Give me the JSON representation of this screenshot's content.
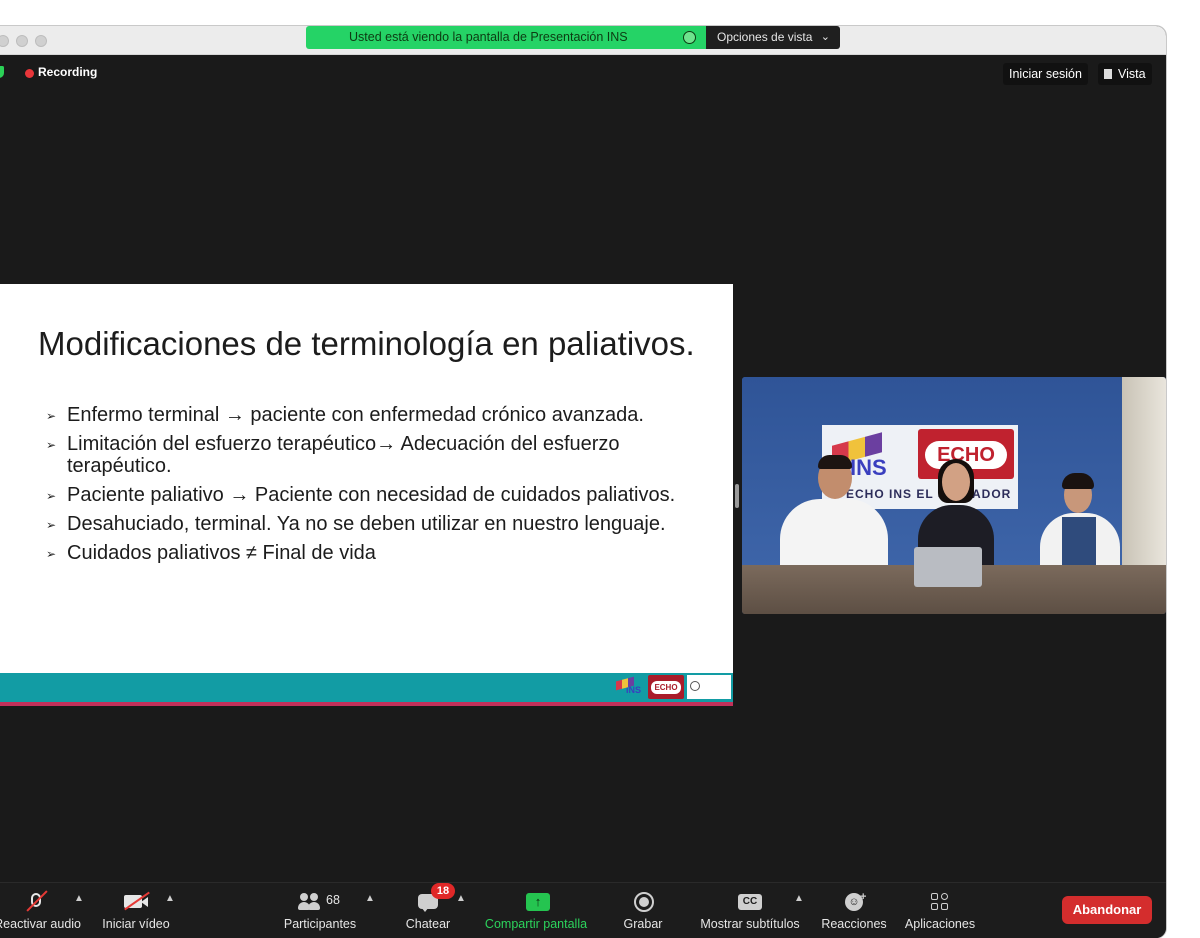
{
  "banner": {
    "sharing_text": "Usted está viendo la pantalla de Presentación INS",
    "view_options_label": "Opciones de vista"
  },
  "top_bar": {
    "recording_label": "Recording",
    "signin_label": "Iniciar sesión",
    "view_label": "Vista"
  },
  "slide": {
    "title": "Modificaciones de terminología en paliativos.",
    "bullets": [
      "Enfermo terminal → paciente con enfermedad crónico avanzada.",
      "Limitación del esfuerzo terapéutico→ Adecuación del esfuerzo terapéutico.",
      "Paciente paliativo → Paciente con necesidad de cuidados paliativos.",
      "Desahuciado, terminal. Ya no se deben utilizar en nuestro lenguaje.",
      "Cuidados paliativos ≠ Final de vida"
    ],
    "bullet_marker": "➢",
    "footer_logos": {
      "ins": "INS",
      "echo": "ECHO"
    }
  },
  "video": {
    "banner_ins": "INS",
    "banner_echo": "ECHO",
    "banner_caption": "ECHO INS EL SALVADOR"
  },
  "toolbar": {
    "audio_label": "Reactivar audio",
    "video_label": "Iniciar vídeo",
    "participants_label": "Participantes",
    "participants_count": "68",
    "chat_label": "Chatear",
    "chat_badge": "18",
    "share_label": "Compartir pantalla",
    "record_label": "Grabar",
    "subtitles_label": "Mostrar subtítulos",
    "subtitles_icon_text": "CC",
    "reactions_label": "Reacciones",
    "apps_label": "Aplicaciones",
    "leave_label": "Abandonar"
  },
  "colors": {
    "share_green": "#25d366",
    "leave_red": "#d42d2d",
    "slide_footer_teal": "#129ca4",
    "slide_footer_magenta": "#c2305a"
  }
}
